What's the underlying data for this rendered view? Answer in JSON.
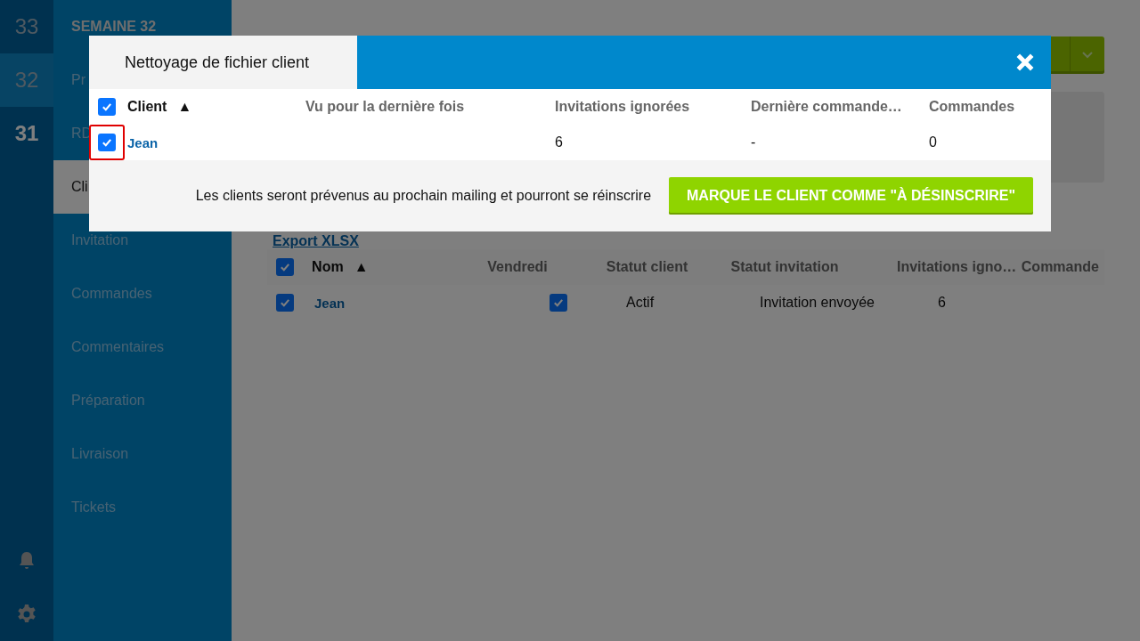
{
  "rail": {
    "weeks": [
      {
        "label": "33",
        "selected": false,
        "current": false
      },
      {
        "label": "32",
        "selected": true,
        "current": false
      },
      {
        "label": "31",
        "selected": false,
        "current": true
      }
    ]
  },
  "sidebar": {
    "title": "SEMAINE 32",
    "items": [
      {
        "label": "Pr",
        "selected": false
      },
      {
        "label": "RD",
        "selected": false
      },
      {
        "label": "Cli",
        "selected": true
      },
      {
        "label": "Invitation",
        "selected": false
      },
      {
        "label": "Commandes",
        "selected": false
      },
      {
        "label": "Commentaires",
        "selected": false
      },
      {
        "label": "Préparation",
        "selected": false
      },
      {
        "label": "Livraison",
        "selected": false
      },
      {
        "label": "Tickets",
        "selected": false
      }
    ]
  },
  "export_link": "Export XLSX",
  "table": {
    "all_checked": true,
    "columns": [
      {
        "label": "Nom",
        "sort_mark": "▲"
      },
      {
        "label": "Vendredi"
      },
      {
        "label": "Statut client"
      },
      {
        "label": "Statut invitation"
      },
      {
        "label": "Invitations igno…"
      },
      {
        "label": "Commande"
      }
    ],
    "rows": [
      {
        "checked": true,
        "name": "Jean",
        "vendredi": true,
        "statut_client": "Actif",
        "statut_invitation": "Invitation envoyée",
        "invitations_ignorees": "6"
      }
    ]
  },
  "modal": {
    "title": "Nettoyage de fichier client",
    "all_checked": true,
    "columns": [
      {
        "label": "Client",
        "sort_mark": "▲"
      },
      {
        "label": "Vu pour la dernière fois"
      },
      {
        "label": "Invitations ignorées"
      },
      {
        "label": "Dernière commande…"
      },
      {
        "label": "Commandes"
      }
    ],
    "rows": [
      {
        "checked": true,
        "focused": true,
        "client": "Jean",
        "invitations_ignorees": "6",
        "derniere_commande": "-",
        "commandes": "0"
      }
    ],
    "note": "Les clients seront prévenus au prochain mailing et pourront se réinscrire",
    "button": "MARQUE LE CLIENT COMME \"À DÉSINSCRIRE\""
  }
}
